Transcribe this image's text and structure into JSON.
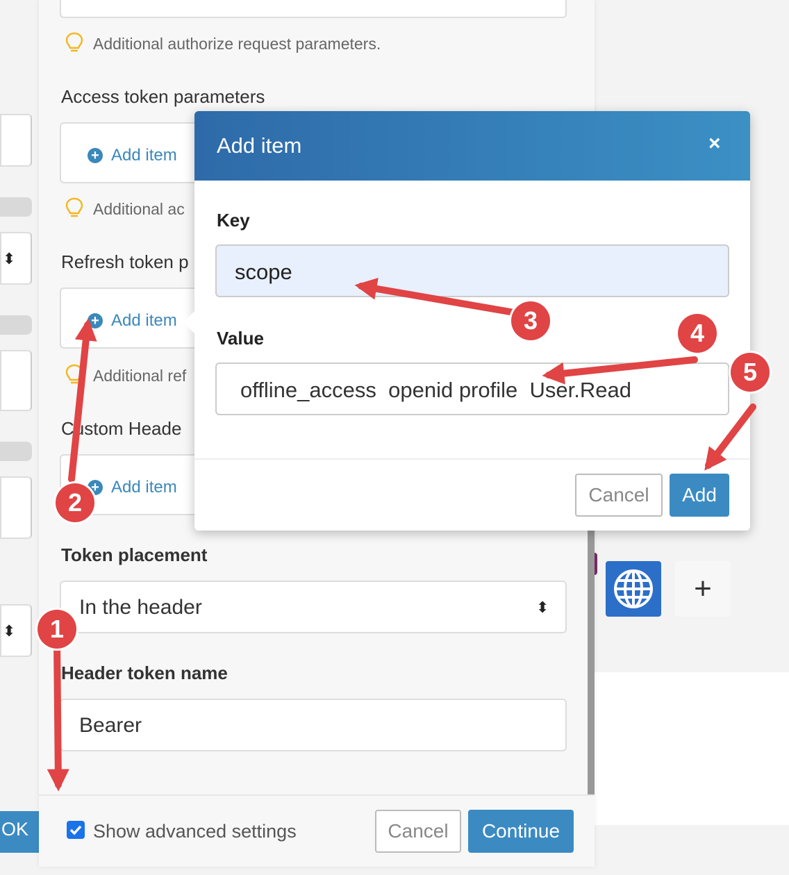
{
  "hints": {
    "authorize": "Additional authorize request parameters.",
    "access": "Additional ac",
    "refresh": "Additional ref"
  },
  "sections": {
    "access_token_parameters": "Access token parameters",
    "refresh_token": "Refresh token p",
    "custom_headers": "Custom Heade",
    "token_placement": "Token placement",
    "header_token_name": "Header token name"
  },
  "add_item_label": "Add item",
  "token_placement_value": "In the header",
  "header_token_name_value": "Bearer",
  "footer": {
    "show_advanced": "Show advanced settings",
    "show_advanced_checked": true,
    "cancel": "Cancel",
    "continue": "Continue",
    "ok_partial": "OK"
  },
  "side_panel": {
    "plus": "+"
  },
  "modal": {
    "title": "Add item",
    "close": "×",
    "key_label": "Key",
    "key_value": "scope",
    "value_label": "Value",
    "value_value": "offline_access  openid profile  User.Read",
    "cancel": "Cancel",
    "add": "Add"
  },
  "annotations": [
    "1",
    "2",
    "3",
    "4",
    "5"
  ],
  "colors": {
    "accent": "#3b8bc2",
    "annotation_red": "#e04445",
    "modal_header_start": "#2e6aa9",
    "modal_header_end": "#3b90c4",
    "key_input_bg": "#e8f0fe",
    "globe_tile": "#2c6fc9"
  }
}
